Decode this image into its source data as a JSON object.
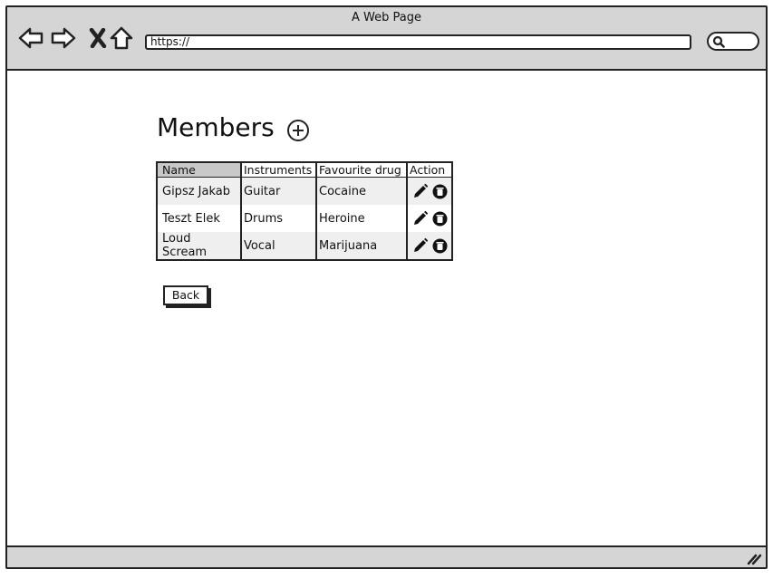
{
  "window": {
    "title": "A Web Page",
    "url": "https://"
  },
  "page": {
    "heading": "Members",
    "table": {
      "headers": {
        "name": "Name",
        "instruments": "Instruments",
        "drug": "Favourite drug",
        "action": "Action"
      },
      "rows": [
        {
          "name": "Gipsz Jakab",
          "instruments": "Guitar",
          "drug": "Cocaine"
        },
        {
          "name": "Teszt Elek",
          "instruments": "Drums",
          "drug": "Heroine"
        },
        {
          "name": "Loud Scream",
          "instruments": "Vocal",
          "drug": "Marijuana"
        }
      ]
    },
    "back_label": "Back"
  },
  "icons": {
    "nav": [
      "back-arrow-icon",
      "forward-arrow-icon",
      "close-icon",
      "home-icon"
    ],
    "search": "search-icon",
    "add": "add-circle-icon",
    "row_actions": [
      "edit-pencil-icon",
      "delete-trash-icon"
    ],
    "resize": "resize-grip-icon"
  },
  "colors": {
    "chrome": "#d5d5d5",
    "ink": "#222222",
    "header_shade": "#c8c8c8",
    "row_shade": "#efefef"
  }
}
